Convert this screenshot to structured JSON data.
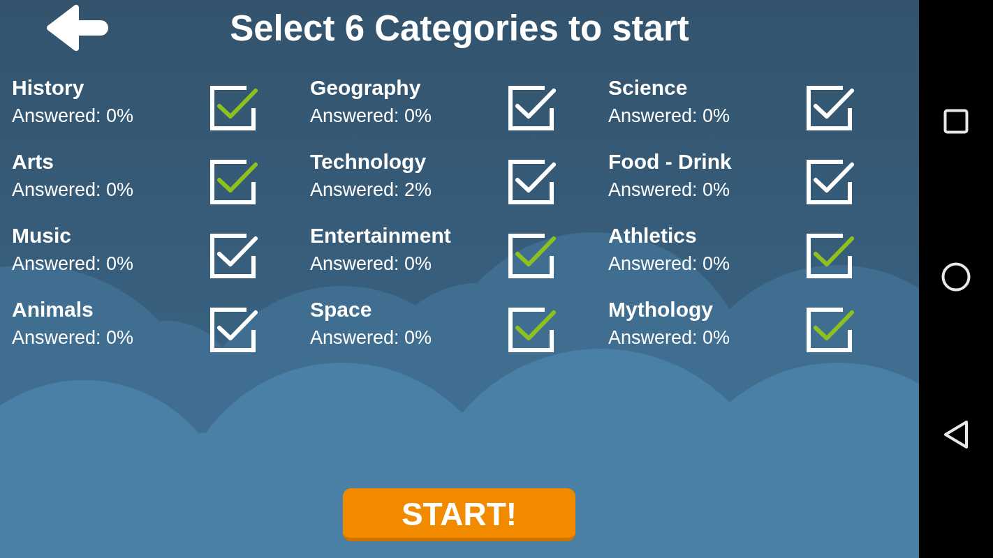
{
  "header": {
    "title": "Select 6 Categories to start"
  },
  "categories": [
    {
      "name": "History",
      "answered": "Answered: 0%",
      "checked": true
    },
    {
      "name": "Geography",
      "answered": "Answered: 0%",
      "checked": false
    },
    {
      "name": "Science",
      "answered": "Answered: 0%",
      "checked": false
    },
    {
      "name": "Arts",
      "answered": "Answered: 0%",
      "checked": true
    },
    {
      "name": "Technology",
      "answered": "Answered: 2%",
      "checked": false
    },
    {
      "name": "Food - Drink",
      "answered": "Answered: 0%",
      "checked": false
    },
    {
      "name": "Music",
      "answered": "Answered: 0%",
      "checked": false
    },
    {
      "name": "Entertainment",
      "answered": "Answered: 0%",
      "checked": true
    },
    {
      "name": "Athletics",
      "answered": "Answered: 0%",
      "checked": true
    },
    {
      "name": "Animals",
      "answered": "Answered: 0%",
      "checked": false
    },
    {
      "name": "Space",
      "answered": "Answered: 0%",
      "checked": true
    },
    {
      "name": "Mythology",
      "answered": "Answered: 0%",
      "checked": true
    }
  ],
  "start_button": {
    "label": "START!"
  }
}
